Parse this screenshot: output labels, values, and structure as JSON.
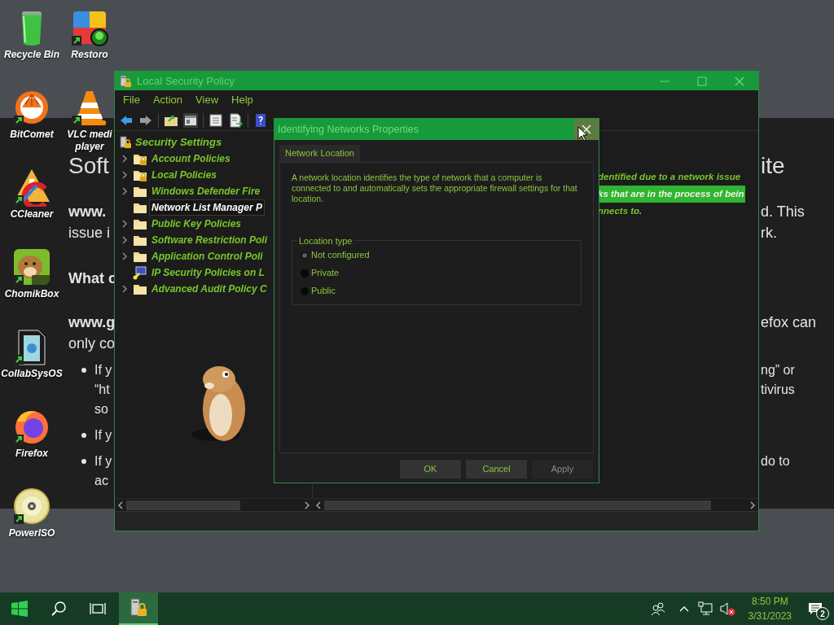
{
  "desktop_icons": [
    {
      "label": "Recycle Bin"
    },
    {
      "label": "BitComet"
    },
    {
      "label": "CCleaner"
    },
    {
      "label": "ChomikBox"
    },
    {
      "label": "CollabSysOS"
    },
    {
      "label": "Firefox"
    },
    {
      "label": "PowerISO"
    },
    {
      "label": "Restoro"
    },
    {
      "label": "VLC medi player"
    }
  ],
  "web_page": {
    "blocks": [
      {
        "kind": "heading",
        "lines": [
          {
            "left": "Soft",
            "left_bold": false,
            "right": "ite"
          }
        ]
      },
      {
        "kind": "paragraph",
        "lines": [
          {
            "left": "www.",
            "left_bold": true,
            "right": "d. This"
          },
          {
            "left": "issue i",
            "left_bold": false,
            "right": "rk."
          }
        ]
      },
      {
        "kind": "subheading",
        "lines": [
          {
            "left": "What c",
            "left_bold": true
          }
        ]
      },
      {
        "kind": "paragraph",
        "lines": [
          {
            "left": "www.g",
            "left_bold": true,
            "right": "efox can"
          },
          {
            "left": "only co",
            "left_bold": false
          }
        ]
      },
      {
        "kind": "bullet",
        "lines": [
          {
            "left": "If y",
            "left_bold": false,
            "right": "ng” or"
          },
          {
            "left": "“ht",
            "left_bold": false,
            "right": "tivirus"
          },
          {
            "left": "so",
            "left_bold": false
          }
        ]
      },
      {
        "kind": "bullet",
        "lines": [
          {
            "left": "If y",
            "left_bold": false
          }
        ]
      },
      {
        "kind": "bullet",
        "lines": [
          {
            "left": "If y",
            "left_bold": false,
            "right": "do to"
          },
          {
            "left": "ac",
            "left_bold": false
          }
        ]
      }
    ]
  },
  "window": {
    "title": "Local Security Policy",
    "menu": [
      "File",
      "Action",
      "View",
      "Help"
    ],
    "tree": {
      "label": "Security Settings",
      "children": [
        {
          "label": "Account Policies",
          "kind": "locked-folder",
          "expandable": true,
          "selected": false
        },
        {
          "label": "Local Policies",
          "kind": "locked-folder",
          "expandable": true,
          "selected": false
        },
        {
          "label": "Windows Defender Fire",
          "kind": "folder",
          "expandable": true,
          "selected": false
        },
        {
          "label": "Network List Manager P",
          "kind": "folder",
          "expandable": false,
          "selected": true
        },
        {
          "label": "Public Key Policies",
          "kind": "folder",
          "expandable": true,
          "selected": false
        },
        {
          "label": "Software Restriction Poli",
          "kind": "folder",
          "expandable": true,
          "selected": false
        },
        {
          "label": "Application Control Poli",
          "kind": "folder",
          "expandable": true,
          "selected": false
        },
        {
          "label": "IP Security Policies on L",
          "kind": "network-policy",
          "expandable": false,
          "selected": false
        },
        {
          "label": "Advanced Audit Policy C",
          "kind": "folder",
          "expandable": true,
          "selected": false
        }
      ]
    },
    "detail_lines": [
      {
        "text": "dentified due to a network issue",
        "highlighted": false
      },
      {
        "text": "ks that are in the process of bein",
        "highlighted": true
      },
      {
        "text": "nnects to.",
        "highlighted": false
      }
    ]
  },
  "dialog": {
    "title": "Identifying Networks Properties",
    "tabs": [
      {
        "label": "Network Location",
        "selected": true
      }
    ],
    "description": "A network location identifies the type of network that a computer is connected to and automatically sets the appropriate firewall settings for that location.",
    "group_label": "Location type",
    "options": [
      {
        "label": "Not configured",
        "selected": true
      },
      {
        "label": "Private",
        "selected": false
      },
      {
        "label": "Public",
        "selected": false
      }
    ],
    "buttons": [
      {
        "label": "OK",
        "disabled": false
      },
      {
        "label": "Cancel",
        "disabled": false
      },
      {
        "label": "Apply",
        "disabled": true
      }
    ]
  },
  "taskbar": {
    "time": "8:50 PM",
    "date": "3/31/2023",
    "notification_count": "2"
  }
}
